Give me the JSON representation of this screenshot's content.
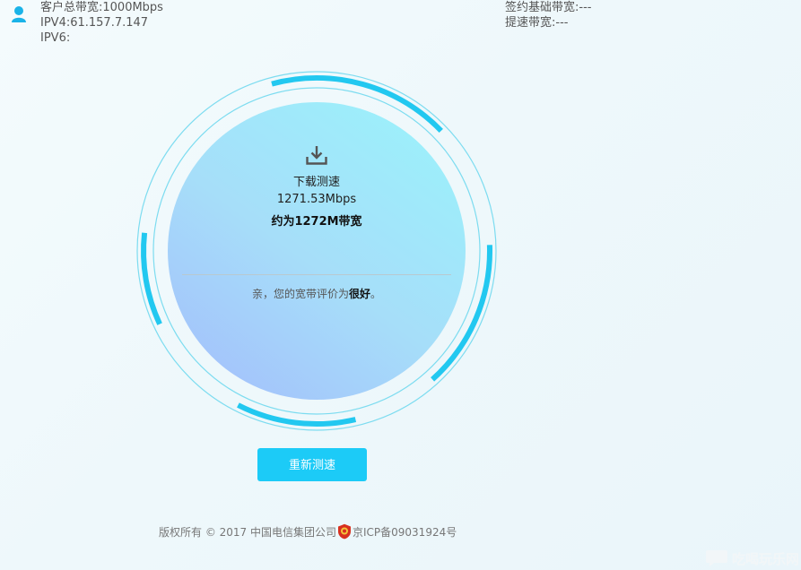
{
  "header": {
    "bandwidth_total": "客户总带宽:1000Mbps",
    "ipv4": "IPV4:61.157.7.147",
    "ipv6": "IPV6:",
    "contract_bandwidth": "签约基础带宽:---",
    "boost_bandwidth": "提速带宽:---"
  },
  "result": {
    "label": "下载测速",
    "speed": "1271.53Mbps",
    "approx": "约为1272M带宽",
    "eval_prefix": "亲，您的宽带评价为",
    "eval_grade": "很好",
    "eval_suffix": "。"
  },
  "retest_label": "重新测速",
  "footer": {
    "copyright": "版权所有 © 2017 中国电信集团公司",
    "icp": "京ICP备09031924号"
  },
  "watermark": "吃喝玩乐网",
  "colors": {
    "accent": "#1ccbf7",
    "arc": "#22c8f0",
    "ring": "#7ddcf0"
  }
}
